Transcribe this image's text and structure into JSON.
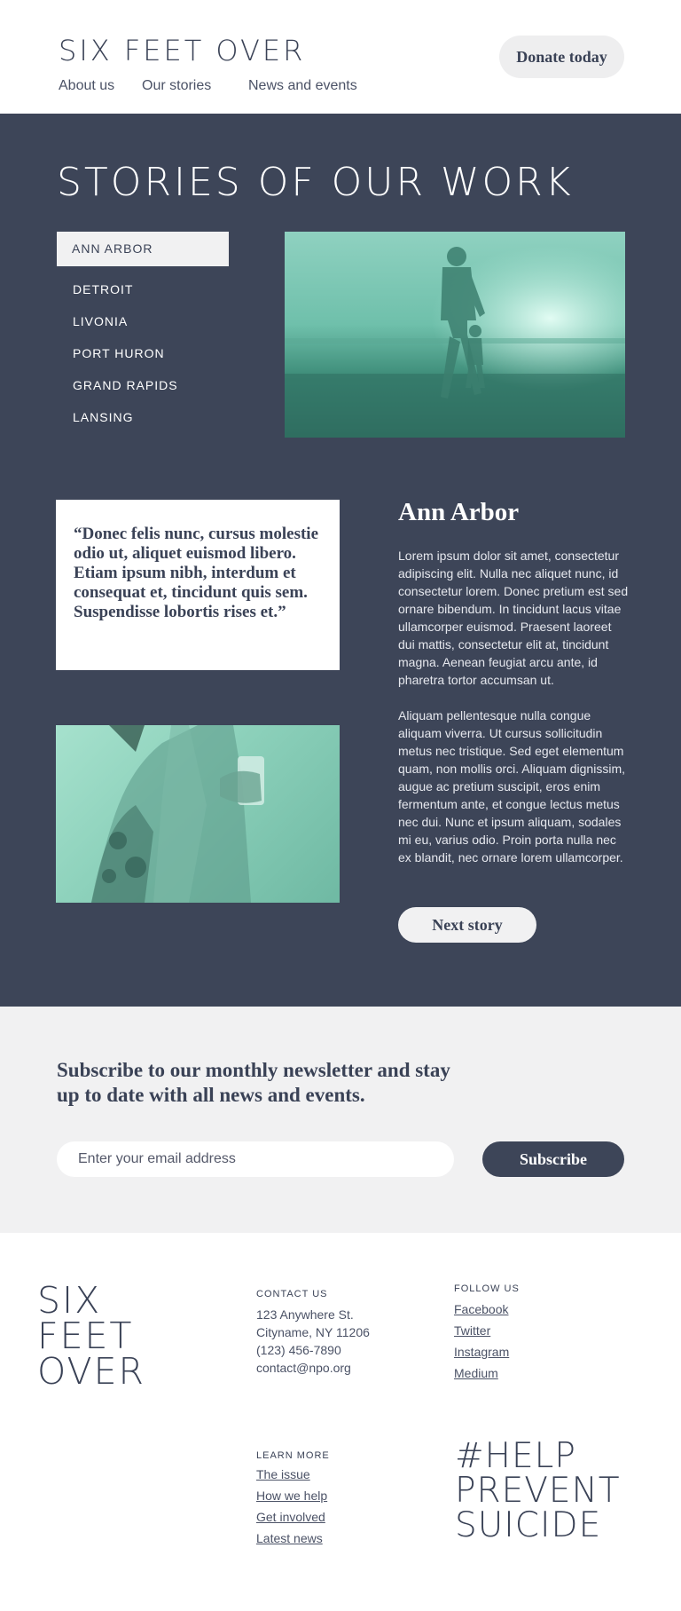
{
  "header": {
    "logo": "SIX FEET OVER",
    "nav": [
      "About us",
      "Our stories",
      "News and events"
    ],
    "donate_label": "Donate today"
  },
  "stories": {
    "title": "STORIES OF OUR WORK",
    "cities": [
      "ANN ARBOR",
      "DETROIT",
      "LIVONIA",
      "PORT HURON",
      "GRAND RAPIDS",
      "LANSING"
    ],
    "active_city": "ANN ARBOR",
    "quote": "“Donec felis nunc, cursus molestie odio ut, aliquet euismod libero. Etiam ipsum nibh, interdum et consequat et, tincidunt quis sem. Suspendisse lobortis rises et.”",
    "story_title": "Ann Arbor",
    "paragraph1": "Lorem ipsum dolor sit amet, consectetur adipiscing elit. Nulla nec aliquet nunc, id consectetur lorem. Donec pretium est sed ornare bibendum. In tincidunt lacus vitae ullamcorper euismod. Praesent laoreet dui mattis, consectetur elit at, tincidunt magna. Aenean feugiat arcu ante, id pharetra tortor accumsan ut.",
    "paragraph2": "Aliquam pellentesque nulla congue aliquam viverra. Ut cursus sollicitudin metus nec tristique. Sed eget elementum quam, non mollis orci. Aliquam dignissim, augue ac pretium suscipit, eros enim fermentum ante, et congue lectus metus nec dui. Nunc et ipsum aliquam, sodales mi eu, varius odio. Proin porta nulla nec ex blandit, nec ornare lorem ullamcorper.",
    "next_label": "Next story"
  },
  "newsletter": {
    "heading": "Subscribe to our monthly newsletter and stay up to date with all news and events.",
    "placeholder": "Enter your email address",
    "subscribe_label": "Subscribe"
  },
  "footer": {
    "logo": "SIX\nFEET\nOVER",
    "contact_label": "CONTACT US",
    "address1": "123 Anywhere St.",
    "address2": "Cityname, NY 11206",
    "phone": "(123) 456-7890",
    "email": "contact@npo.org",
    "follow_label": "FOLLOW US",
    "social": [
      "Facebook",
      "Twitter",
      "Instagram",
      "Medium"
    ],
    "learn_label": "LEARN MORE",
    "learn_links": [
      "The issue",
      "How we help",
      "Get involved",
      "Latest news"
    ],
    "hashtag": "#HELP\nPREVENT\nSUICIDE"
  },
  "colors": {
    "navy": "#3d4558",
    "light_gray": "#f1f1f2",
    "mint": "#8fd1c0"
  }
}
